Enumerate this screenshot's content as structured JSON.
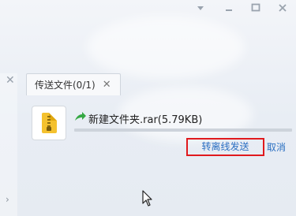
{
  "window_controls": {
    "menu": "▾",
    "minimize": "−",
    "maximize": "□",
    "close": "✕"
  },
  "sidebar": {
    "close": "✕",
    "expand": "›"
  },
  "transfer_panel": {
    "tab_label": "传送文件(0/1)",
    "tab_close": "✕"
  },
  "file": {
    "icon": "zip-archive-icon",
    "name": "新建文件夹.rar(5.79KB)",
    "progress": 0
  },
  "actions": {
    "send_offline": "转离线发送",
    "cancel": "取消"
  },
  "colors": {
    "link": "#2b6fc2",
    "highlight_border": "#e0191d",
    "send_arrow": "#35a843",
    "zip_icon": "#f4c12e"
  }
}
